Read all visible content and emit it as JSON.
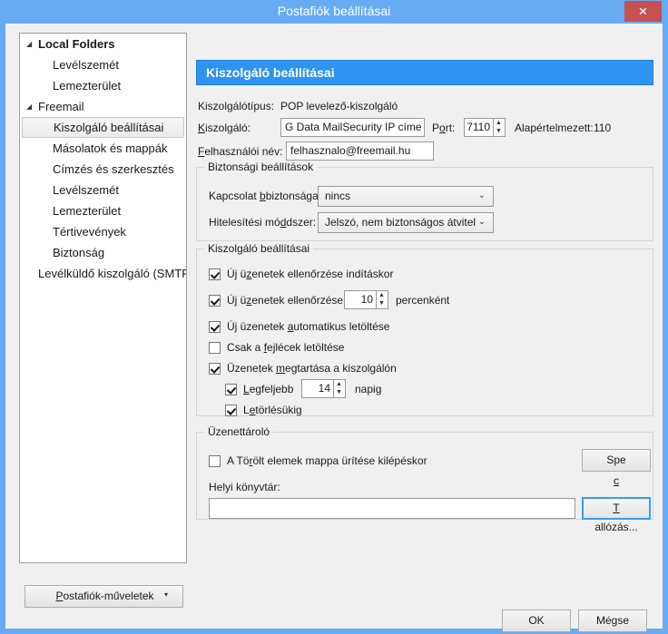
{
  "window": {
    "title": "Postafiók beállításai",
    "close_label": "✕",
    "accent_blue": "#67abf3",
    "header_blue": "#2f93f0",
    "close_red": "#c75050"
  },
  "sidebar": {
    "items": [
      {
        "label": "Local Folders",
        "level": 0,
        "bold": true,
        "twisty": "◢",
        "selected": false
      },
      {
        "label": "Levélszemét",
        "level": 1,
        "bold": false,
        "twisty": "",
        "selected": false
      },
      {
        "label": "Lemezterület",
        "level": 1,
        "bold": false,
        "twisty": "",
        "selected": false
      },
      {
        "label": "Freemail",
        "level": 0,
        "bold": false,
        "twisty": "◢",
        "selected": false
      },
      {
        "label": "Kiszolgáló beállításai",
        "level": 1,
        "bold": false,
        "twisty": "",
        "selected": true
      },
      {
        "label": "Másolatok és mappák",
        "level": 1,
        "bold": false,
        "twisty": "",
        "selected": false
      },
      {
        "label": "Címzés és szerkesztés",
        "level": 1,
        "bold": false,
        "twisty": "",
        "selected": false
      },
      {
        "label": "Levélszemét",
        "level": 1,
        "bold": false,
        "twisty": "",
        "selected": false
      },
      {
        "label": "Lemezterület",
        "level": 1,
        "bold": false,
        "twisty": "",
        "selected": false
      },
      {
        "label": "Tértivevények",
        "level": 1,
        "bold": false,
        "twisty": "",
        "selected": false
      },
      {
        "label": "Biztonság",
        "level": 1,
        "bold": false,
        "twisty": "",
        "selected": false
      },
      {
        "label": "Levélküldő kiszolgáló (SMTP)",
        "level": 0,
        "bold": false,
        "twisty": "",
        "selected": false
      }
    ],
    "account_actions_label": "Postafiók-műveletek",
    "account_actions_arrow": "▾"
  },
  "panel": {
    "header": "Kiszolgáló beállításai",
    "server_type_label": "Kiszolgálótípus:",
    "server_type_value": "POP levelező-kiszolgáló",
    "server_label": "Kiszolgáló:",
    "server_value": "G Data MailSecurity IP címe",
    "port_label": "Port:",
    "port_value": "7110",
    "default_label": "Alapértelmezett:",
    "default_value": "110",
    "username_label": "Felhasználói név:",
    "username_value": "felhasznalo@freemail.hu"
  },
  "security_group": {
    "title": "Biztonsági beállítások",
    "connection_label": "Kapcsolat biztonsága:",
    "connection_value": "nincs",
    "auth_label": "Hitelesítési módszer:",
    "auth_value": "Jelszó, nem biztonságos átvitel",
    "arrow": "⌄"
  },
  "server_group": {
    "title": "Kiszolgáló beállításai",
    "check_at_startup": {
      "label": "Új üzenetek ellenőrzése indításkor",
      "checked": true
    },
    "check_every": {
      "label": "Új üzenetek ellenőrzése",
      "checked": true,
      "value": "10",
      "suffix": "percenként"
    },
    "auto_download": {
      "label": "Új üzenetek automatikus letöltése",
      "checked": true
    },
    "headers_only": {
      "label": "Csak a fejlécek letöltése",
      "checked": false
    },
    "leave_on_server": {
      "label": "Üzenetek megtartása a kiszolgálón",
      "checked": true
    },
    "at_most": {
      "label": "Legfeljebb",
      "checked": true,
      "value": "14",
      "suffix": "napig"
    },
    "until_deleted": {
      "label": "Letörlésükig",
      "checked": true
    }
  },
  "store_group": {
    "title": "Üzenettároló",
    "empty_trash": {
      "label": "A Törölt elemek mappa ürítése kilépéskor",
      "checked": false
    },
    "advanced_button": "Speciális...",
    "local_dir_label": "Helyi könyvtár:",
    "local_dir_value": "",
    "browse_button": "Tallózás..."
  },
  "footer": {
    "ok": "OK",
    "cancel": "Mégse"
  },
  "spinner": {
    "up": "▲",
    "down": "▼"
  }
}
